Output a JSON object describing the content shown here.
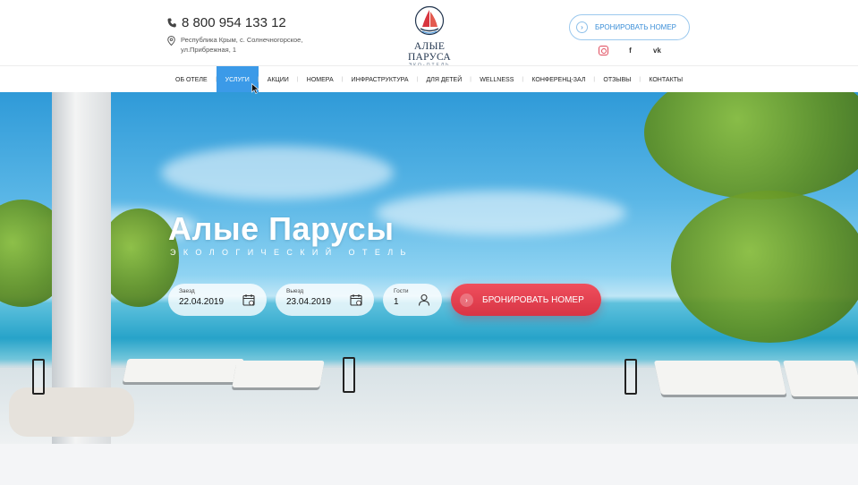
{
  "header": {
    "phone": "8 800 954 133 12",
    "address_line1": "Республика Крым, с. Солнечногорское,",
    "address_line2": "ул.Прибрежная, 1",
    "logo_name": "АЛЫЕ ПАРУСА",
    "logo_sub": "ЭКО-ОТЕЛЬ",
    "book_button": "БРОНИРОВАТЬ НОМЕР",
    "socials": {
      "facebook": "f",
      "vk": "vk"
    }
  },
  "nav": {
    "items": [
      {
        "label": "ОБ ОТЕЛЕ",
        "active": false
      },
      {
        "label": "УСЛУГИ",
        "active": true
      },
      {
        "label": "АКЦИИ",
        "active": false
      },
      {
        "label": "НОМЕРА",
        "active": false
      },
      {
        "label": "ИНФРАСТРУКТУРА",
        "active": false
      },
      {
        "label": "ДЛЯ ДЕТЕЙ",
        "active": false
      },
      {
        "label": "WELLNESS",
        "active": false
      },
      {
        "label": "КОНФЕРЕНЦ-ЗАЛ",
        "active": false
      },
      {
        "label": "ОТЗЫВЫ",
        "active": false
      },
      {
        "label": "КОНТАКТЫ",
        "active": false
      }
    ]
  },
  "hero": {
    "title": "Алые Парусы",
    "subtitle": "Экологический отель",
    "checkin_label": "Заезд",
    "checkin_value": "22.04.2019",
    "checkout_label": "Выезд",
    "checkout_value": "23.04.2019",
    "guests_label": "Гости",
    "guests_value": "1",
    "book_button": "БРОНИРОВАТЬ НОМЕР"
  },
  "colors": {
    "accent_blue": "#3b9ae8",
    "book_red": "#e0404f",
    "logo_sail": "#d8353f",
    "logo_navy": "#23364f"
  },
  "icons": [
    "phone-icon",
    "location-pin-icon",
    "logo-sail-icon",
    "arrow-right-icon",
    "instagram-icon",
    "facebook-icon",
    "vk-icon",
    "calendar-icon",
    "user-icon",
    "mouse-cursor-icon"
  ]
}
